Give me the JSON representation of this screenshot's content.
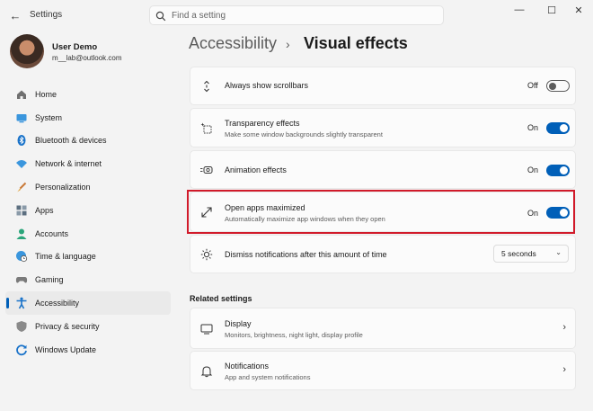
{
  "window": {
    "title": "Settings",
    "back_glyph": "←",
    "minimize_glyph": "—",
    "maximize_glyph": "☐",
    "close_glyph": "✕"
  },
  "search": {
    "placeholder": "Find a setting",
    "value": ""
  },
  "user": {
    "name": "User Demo",
    "email": "m__lab@outlook.com"
  },
  "sidebar": {
    "items": [
      {
        "label": "Home",
        "icon": "home-icon"
      },
      {
        "label": "System",
        "icon": "system-icon"
      },
      {
        "label": "Bluetooth & devices",
        "icon": "bluetooth-icon"
      },
      {
        "label": "Network & internet",
        "icon": "network-icon"
      },
      {
        "label": "Personalization",
        "icon": "brush-icon"
      },
      {
        "label": "Apps",
        "icon": "apps-icon"
      },
      {
        "label": "Accounts",
        "icon": "accounts-icon"
      },
      {
        "label": "Time & language",
        "icon": "globe-clock-icon"
      },
      {
        "label": "Gaming",
        "icon": "gamepad-icon"
      },
      {
        "label": "Accessibility",
        "icon": "accessibility-icon"
      },
      {
        "label": "Privacy & security",
        "icon": "shield-icon"
      },
      {
        "label": "Windows Update",
        "icon": "update-icon"
      }
    ],
    "active_index": 9
  },
  "header": {
    "parent": "Accessibility",
    "separator": "›",
    "current": "Visual effects"
  },
  "settings": {
    "scrollbars": {
      "title": "Always show scrollbars",
      "state": "Off",
      "on": false
    },
    "transparency": {
      "title": "Transparency effects",
      "subtitle": "Make some window backgrounds slightly transparent",
      "state": "On",
      "on": true
    },
    "animation": {
      "title": "Animation effects",
      "state": "On",
      "on": true
    },
    "maximize": {
      "title": "Open apps maximized",
      "subtitle": "Automatically maximize app windows when they open",
      "state": "On",
      "on": true
    },
    "notifications_timeout": {
      "title": "Dismiss notifications after this amount of time",
      "value": "5 seconds",
      "chevron": "⌄"
    }
  },
  "related": {
    "heading": "Related settings",
    "items": [
      {
        "title": "Display",
        "subtitle": "Monitors, brightness, night light, display profile",
        "chevron": "›"
      },
      {
        "title": "Notifications",
        "subtitle": "App and system notifications",
        "chevron": "›"
      }
    ]
  },
  "colors": {
    "accent": "#005fb8",
    "highlight": "#d11a2a",
    "background": "#f3f3f3",
    "card": "#fbfbfb"
  }
}
